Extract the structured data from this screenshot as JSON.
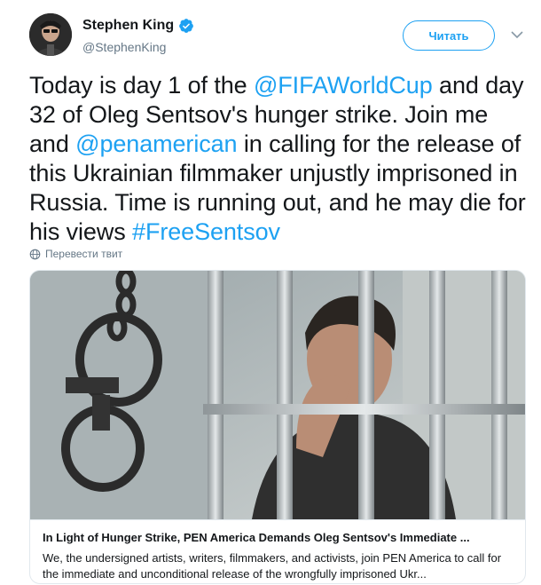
{
  "author": {
    "display_name": "Stephen King",
    "handle": "@StephenKing",
    "verified_icon": "verified-badge-icon",
    "avatar_icon": "avatar-photo"
  },
  "follow_button": {
    "label": "Читать"
  },
  "more_menu_icon": "chevron-down-icon",
  "tweet": {
    "segments": [
      {
        "text": "Today is day 1 of the ",
        "link": false
      },
      {
        "text": "@FIFAWorldCup",
        "link": true
      },
      {
        "text": " and day 32 of Oleg Sentsov's hunger strike. Join me and ",
        "link": false
      },
      {
        "text": "@penamerican",
        "link": true
      },
      {
        "text": " in calling for the release of this Ukrainian filmmaker unjustly imprisoned in Russia. Time is running out, and he may die for his views ",
        "link": false
      },
      {
        "text": "#FreeSentsov",
        "link": true
      }
    ]
  },
  "translate": {
    "label": "Перевести твит",
    "icon": "globe-icon"
  },
  "card": {
    "image": "photo of man behind bars with handcuffs",
    "title": "In Light of Hunger Strike, PEN America Demands Oleg Sentsov's Immediate ...",
    "description": "We, the undersigned artists, writers, filmmakers, and activists, join PEN America to call for the immediate and unconditional release of the wrongfully imprisoned Ukr..."
  },
  "colors": {
    "link": "#1da1f2",
    "text": "#14171a",
    "secondary": "#657786",
    "border": "#e1e8ed"
  }
}
